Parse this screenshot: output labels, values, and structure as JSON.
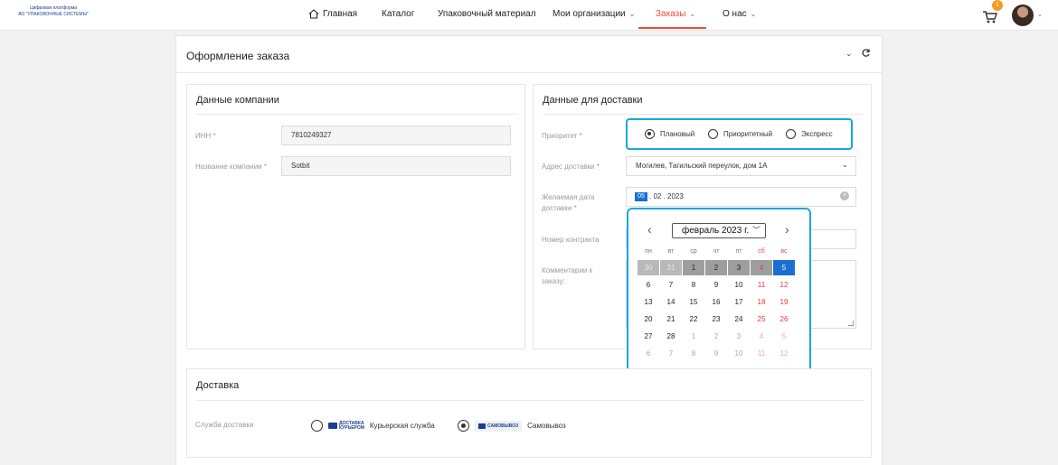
{
  "header": {
    "logo_line1": "Цифровая платформа",
    "logo_line2": "АО \"УПАКОВОЧНЫЕ СИСТЕМЫ\"",
    "nav": [
      {
        "label": "Главная",
        "has_chevron": false,
        "icon": "home-icon"
      },
      {
        "label": "Каталог",
        "has_chevron": false
      },
      {
        "label": "Упаковочный материал",
        "has_chevron": false
      },
      {
        "label": "Мои организации",
        "has_chevron": true
      },
      {
        "label": "Заказы",
        "has_chevron": true,
        "active": true
      },
      {
        "label": "О нас",
        "has_chevron": true
      }
    ],
    "cart_count": "1",
    "accent_color": "#e94c3a"
  },
  "order": {
    "title": "Оформление заказа"
  },
  "company": {
    "title": "Данные компании",
    "inn_label": "ИНН *",
    "inn_value": "7810249327",
    "name_label": "Название компании *",
    "name_value": "Sotbit"
  },
  "shipping": {
    "title": "Данные для доставки",
    "priority_label": "Приоритет *",
    "priority_options": [
      "Плановый",
      "Приоритетный",
      "Экспресс"
    ],
    "priority_selected": "Плановый",
    "address_label": "Адрес доставки *",
    "address_value": "Могилев, Тагильский переулок, дом 1А",
    "date_label": "Желаемая дата доставки *",
    "date_day": "05",
    "date_rest": ". 02 . 2023",
    "contract_label": "Номер контракта",
    "comment_label": "Комментарии к заказу:"
  },
  "calendar": {
    "month": "февраль 2023 г.",
    "prev_glyph": "‹",
    "next_glyph": "›",
    "weekdays": [
      "пн",
      "вт",
      "ср",
      "чт",
      "пт",
      "сб",
      "вс"
    ],
    "weeks": [
      [
        "30",
        "31",
        "1",
        "2",
        "3",
        "4",
        "5"
      ],
      [
        "6",
        "7",
        "8",
        "9",
        "10",
        "11",
        "12"
      ],
      [
        "13",
        "14",
        "15",
        "16",
        "17",
        "18",
        "19"
      ],
      [
        "20",
        "21",
        "22",
        "23",
        "24",
        "25",
        "26"
      ],
      [
        "27",
        "28",
        "1",
        "2",
        "3",
        "4",
        "5"
      ],
      [
        "6",
        "7",
        "8",
        "9",
        "10",
        "11",
        "12"
      ]
    ],
    "selected_day": "5",
    "selection_color": "#1a6fd3"
  },
  "delivery": {
    "title": "Доставка",
    "service_label": "Служба доставки",
    "options": [
      {
        "logo_line1": "ДОСТАВКА",
        "logo_line2": "КУРЬЕРОМ",
        "label": "Курьерская служба",
        "selected": false
      },
      {
        "logo_text": "САМОВЫВОЗ",
        "label": "Самовывоз",
        "selected": true
      }
    ]
  }
}
